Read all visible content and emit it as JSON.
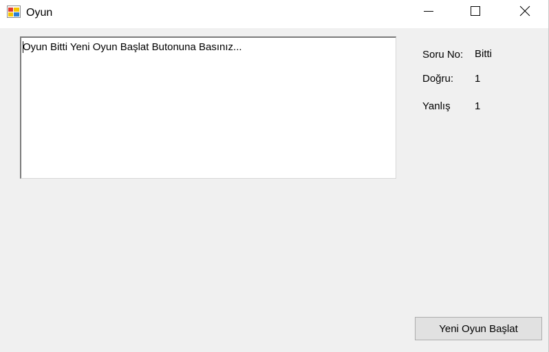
{
  "window": {
    "title": "Oyun",
    "app_icon": "windows-form-icon",
    "controls": {
      "minimize_icon": "minimize-icon",
      "maximize_icon": "maximize-icon",
      "close_icon": "close-icon"
    }
  },
  "textbox": {
    "value": "Oyun Bitti Yeni Oyun Başlat Butonuna Basınız..."
  },
  "stats": {
    "question_label": "Soru No:",
    "question_value": "Bitti",
    "correct_label": "Doğru:",
    "correct_value": "1",
    "wrong_label": "Yanlış",
    "wrong_value": "1"
  },
  "buttons": {
    "new_game_label": "Yeni Oyun Başlat"
  },
  "colors": {
    "window_background": "#f0f0f0",
    "titlebar_background": "#ffffff",
    "button_background": "#e1e1e1",
    "button_border": "#adadad"
  }
}
